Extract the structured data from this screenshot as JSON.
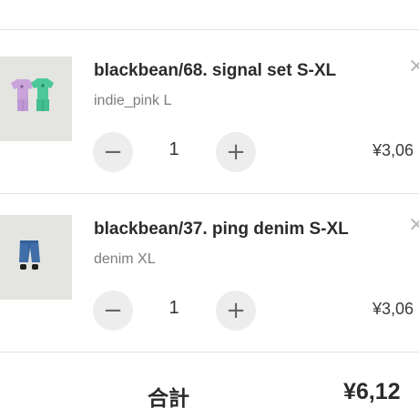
{
  "cart": {
    "items": [
      {
        "title": "blackbean/68. signal set S-XL",
        "variant": "indie_pink L",
        "quantity": "1",
        "price": "¥3,06",
        "remove_icon": "close-icon",
        "minus_label": "−",
        "plus_label": "+",
        "remove_label": "×"
      },
      {
        "title": "blackbean/37. ping denim S-XL",
        "variant": "denim XL",
        "quantity": "1",
        "price": "¥3,06",
        "remove_icon": "close-icon",
        "minus_label": "−",
        "plus_label": "+",
        "remove_label": "×"
      }
    ]
  },
  "summary": {
    "total_label": "合計",
    "total_value": "¥6,12"
  },
  "colors": {
    "divider": "#e3e3e3",
    "qty_button_bg": "#ededed",
    "variant_text": "#7d7d7d",
    "pink_top": "#c7a0d8",
    "green_top": "#4cc79a",
    "denim": "#3f6ea8"
  }
}
